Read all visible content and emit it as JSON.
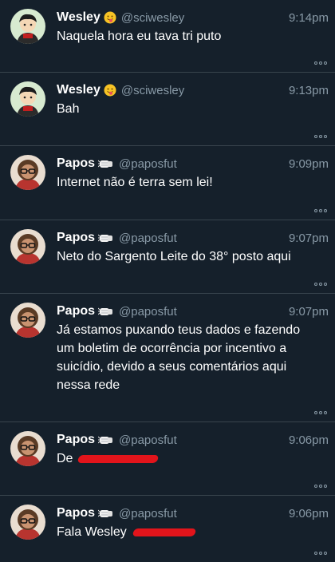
{
  "tweets": [
    {
      "name": "Wesley",
      "emoji": "tongue-face-emoji",
      "handle": "@sciwesley",
      "time": "9:14pm",
      "lines": [
        "Naquela hora eu tava tri puto"
      ],
      "avatar": "cartoon-avatar"
    },
    {
      "name": "Wesley",
      "emoji": "tongue-face-emoji",
      "handle": "@sciwesley",
      "time": "9:13pm",
      "lines": [
        "Bah"
      ],
      "avatar": "cartoon-avatar"
    },
    {
      "name": "Papos",
      "emoji": "fist-bump-emoji",
      "handle": "@paposfut",
      "time": "9:09pm",
      "lines": [
        "Internet não é terra sem lei!"
      ],
      "avatar": "glasses-avatar"
    },
    {
      "name": "Papos",
      "emoji": "fist-bump-emoji",
      "handle": "@paposfut",
      "time": "9:07pm",
      "lines": [
        "Neto do Sargento Leite do 38° posto aqui"
      ],
      "avatar": "glasses-avatar"
    },
    {
      "name": "Papos",
      "emoji": "fist-bump-emoji",
      "handle": "@paposfut",
      "time": "9:07pm",
      "lines": [
        "Já estamos puxando teus dados e fazendo",
        "um boletim de ocorrência por incentivo a",
        "suicídio, devido a seus comentários aqui",
        "nessa rede"
      ],
      "avatar": "glasses-avatar"
    },
    {
      "name": "Papos",
      "emoji": "fist-bump-emoji",
      "handle": "@paposfut",
      "time": "9:06pm",
      "lines": [
        "De"
      ],
      "redacted": true,
      "avatar": "glasses-avatar"
    },
    {
      "name": "Papos",
      "emoji": "fist-bump-emoji",
      "handle": "@paposfut",
      "time": "9:06pm",
      "lines": [
        "Fala Wesley"
      ],
      "redacted": true,
      "avatar": "glasses-avatar"
    }
  ],
  "colors": {
    "background": "#15202b",
    "divider": "#38444d",
    "muted": "#8899a6",
    "text": "#ffffff",
    "redaction": "#e2141b"
  },
  "icons": {
    "more": "more-options-icon"
  }
}
